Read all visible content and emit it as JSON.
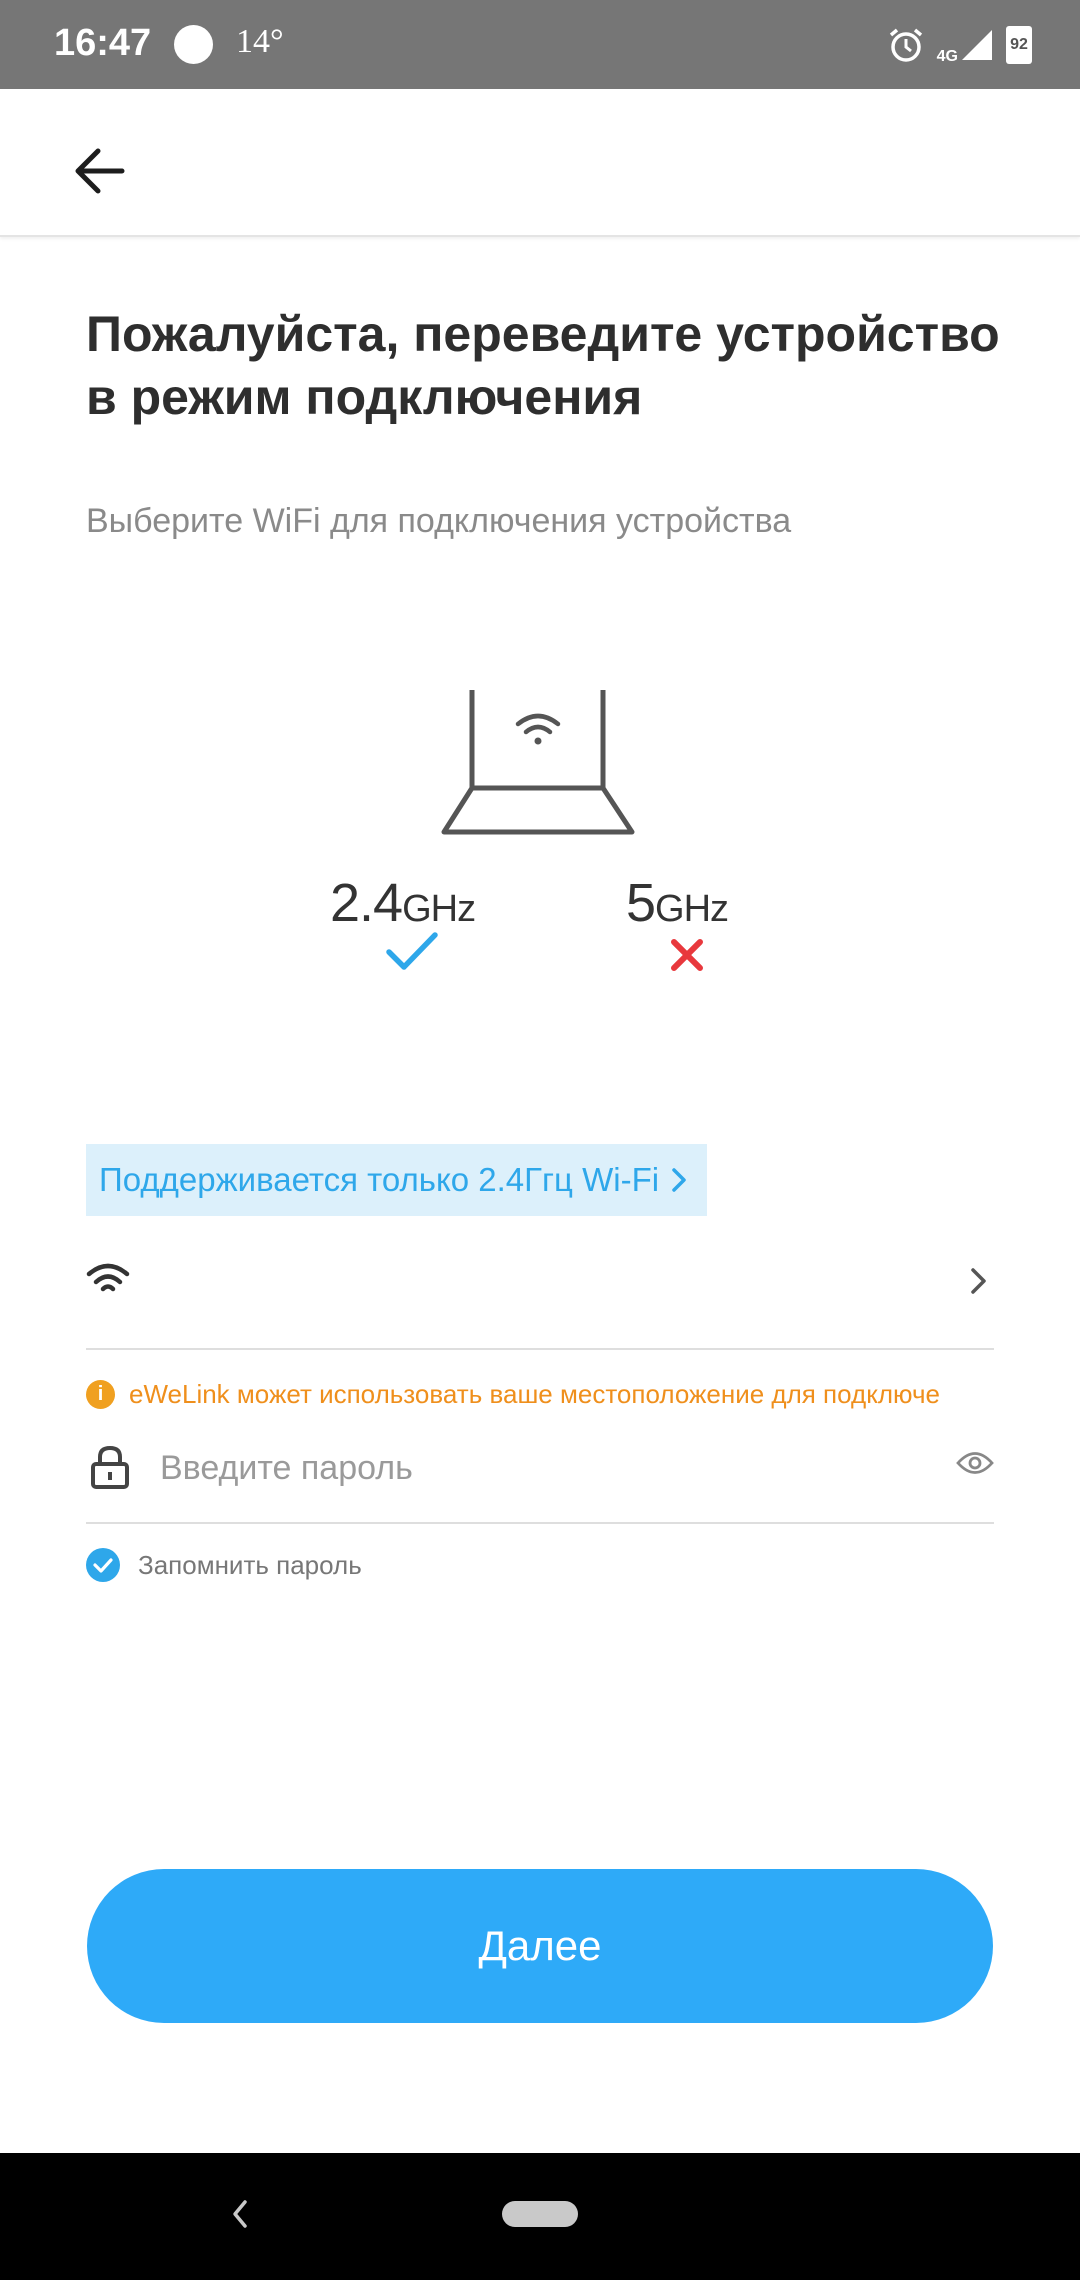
{
  "status_bar": {
    "time": "16:47",
    "temperature": "14°",
    "network": "4G",
    "battery": "92"
  },
  "header": {
    "back_icon": "arrow-left-icon"
  },
  "content": {
    "title": "Пожалуйста, переведите устройство в режим подключения",
    "subtitle": "Выберите WiFi для подключения устройства",
    "bands": [
      {
        "value": "2.4",
        "unit": "GHz",
        "status": "supported"
      },
      {
        "value": "5",
        "unit": "GHz",
        "status": "unsupported"
      }
    ],
    "banner_text": "Поддерживается только 2.4Ггц Wi-Fi",
    "wifi_ssid": "",
    "location_warning": "eWeLink может использовать ваше местоположение для подключе",
    "password_placeholder": "Введите пароль",
    "password_value": "",
    "remember_label": "Запомнить пароль",
    "remember_checked": true,
    "next_label": "Далее"
  },
  "colors": {
    "accent": "#2eaaf8",
    "banner_bg": "#dcf0fb",
    "warning": "#ef8f1c",
    "error": "#e8383d"
  }
}
